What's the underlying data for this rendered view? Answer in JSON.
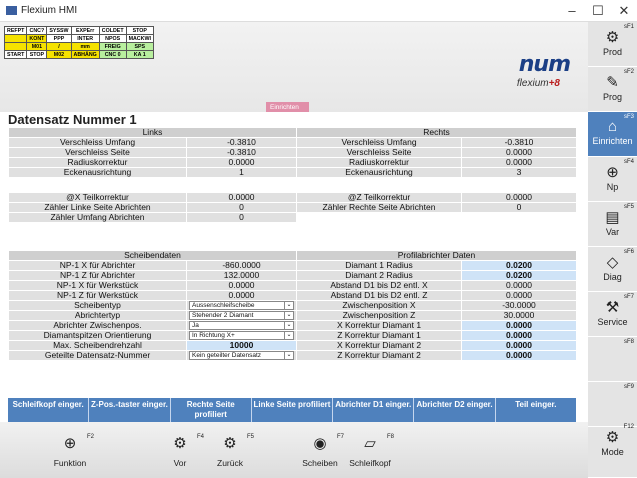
{
  "window": {
    "title": "Flexium HMI",
    "minimize": "–",
    "maximize": "☐",
    "close": "✕"
  },
  "status": {
    "row1": [
      "REFPT",
      "CNC?",
      "SYSSW",
      "EXPErr",
      "COLDET",
      "STOP"
    ],
    "row2": [
      "",
      "KONT",
      "PPP",
      "INTER",
      "NPOS",
      "MACKWI"
    ],
    "row3": [
      "",
      "M01",
      "/",
      "mm",
      "FREIG",
      "SPS"
    ],
    "row4": [
      "START",
      "STOP",
      "M02",
      "ABHÄNG",
      "CNC 0",
      "KA 1"
    ]
  },
  "logo": {
    "brand": "num",
    "sub_a": "flexium",
    "sub_b": "+8"
  },
  "mode_tab": "Einrichten",
  "page_title": "Datensatz Nummer 1",
  "top_table": {
    "left_header": "Links",
    "right_header": "Rechts",
    "rows": [
      [
        "Verschleiss Umfang",
        "-0.3810",
        "Verschleiss Umfang",
        "-0.3810"
      ],
      [
        "Verschleiss Seite",
        "-0.3810",
        "Verschleiss Seite",
        "0.0000"
      ],
      [
        "Radiuskorrektur",
        "0.0000",
        "Radiuskorrektur",
        "0.0000"
      ],
      [
        "Eckenausrichtung",
        "1",
        "Eckenausrichtung",
        "3"
      ]
    ]
  },
  "mid_table": {
    "rows": [
      [
        "@X Teilkorrektur",
        "0.0000",
        "@Z Teilkorrektur",
        "0.0000"
      ],
      [
        "Zähler Linke Seite Abrichten",
        "0",
        "Zähler Rechte Seite Abrichten",
        "0"
      ],
      [
        "Zähler Umfang Abrichten",
        "0",
        "",
        ""
      ]
    ]
  },
  "bottom_table": {
    "left_header": "Scheibendaten",
    "right_header": "Profilabrichter Daten",
    "rows": [
      {
        "l": "NP-1 X für Abrichter",
        "lv": "-860.0000",
        "r": "Diamant 1 Radius",
        "rv": "0.0200",
        "rb": true
      },
      {
        "l": "NP-1 Z für Abrichter",
        "lv": "132.0000",
        "r": "Diamant 2 Radius",
        "rv": "0.0200",
        "rb": true
      },
      {
        "l": "NP-1 X für Werkstück",
        "lv": "0.0000",
        "r": "Abstand D1 bis D2 entl. X",
        "rv": "0.0000"
      },
      {
        "l": "NP-1 Z für Werkstück",
        "lv": "0.0000",
        "r": "Abstand D1 bis D2 entl. Z",
        "rv": "0.0000"
      },
      {
        "l": "Scheibentyp",
        "ld": "Aussenschleifscheibe",
        "r": "Zwischenposition X",
        "rv": "-30.0000"
      },
      {
        "l": "Abrichtertyp",
        "ld": "Stehender 2 Diamant",
        "r": "Zwischenposition Z",
        "rv": "30.0000"
      },
      {
        "l": "Abrichter Zwischenpos.",
        "ld": "Ja",
        "r": "X Korrektur Diamant 1",
        "rv": "0.0000",
        "rb": true
      },
      {
        "l": "Diamantspitzen Orientierung",
        "ld": "In Richtung X+",
        "r": "Z Korrektur Diamant 1",
        "rv": "0.0000",
        "rb": true
      },
      {
        "l": "Max. Scheibendrehzahl",
        "lv": "10000",
        "lb": true,
        "r": "X Korrektur Diamant 2",
        "rv": "0.0000",
        "rb": true
      },
      {
        "l": "Geteilte Datensatz-Nummer",
        "ld": "Kein geteilter Datensatz",
        "r": "Z Korrektur Diamant 2",
        "rv": "0.0000",
        "rb": true
      }
    ]
  },
  "softkeys": [
    "Schleifkopf einger.",
    "Z-Pos.-taster einger.",
    "Rechte Seite profiliert",
    "Linke Seite profiliert",
    "Abrichter D1 einger.",
    "Abrichter D2 einger.",
    "Teil einger."
  ],
  "sidebar": [
    {
      "label": "Prod",
      "num": "sF1",
      "icon": "⚙"
    },
    {
      "label": "Prog",
      "num": "sF2",
      "icon": "✎"
    },
    {
      "label": "Einrichten",
      "num": "sF3",
      "icon": "⌂"
    },
    {
      "label": "Np",
      "num": "sF4",
      "icon": "⊕"
    },
    {
      "label": "Var",
      "num": "sF5",
      "icon": "▤"
    },
    {
      "label": "Diag",
      "num": "sF6",
      "icon": "◇"
    },
    {
      "label": "Service",
      "num": "sF7",
      "icon": "⚒"
    },
    {
      "label": "",
      "num": "sF8",
      "icon": ""
    },
    {
      "label": "",
      "num": "sF9",
      "icon": ""
    },
    {
      "label": "Mode",
      "num": "F12",
      "icon": "⚙"
    }
  ],
  "bottom_keys": [
    {
      "label": "Funktion",
      "num": "F2",
      "icon": "⊕"
    },
    {
      "label": "Vor",
      "num": "F4",
      "icon": "⚙"
    },
    {
      "label": "Zurück",
      "num": "F5",
      "icon": "⚙"
    },
    {
      "label": "Scheiben",
      "num": "F7",
      "icon": "◉"
    },
    {
      "label": "Schleifkopf",
      "num": "F8",
      "icon": "▱"
    }
  ],
  "colors": {
    "accent": "#4f81bd",
    "mode_tab": "#e18fa9",
    "status_yellow": "#f5e200",
    "status_green": "#b8ef9e"
  }
}
